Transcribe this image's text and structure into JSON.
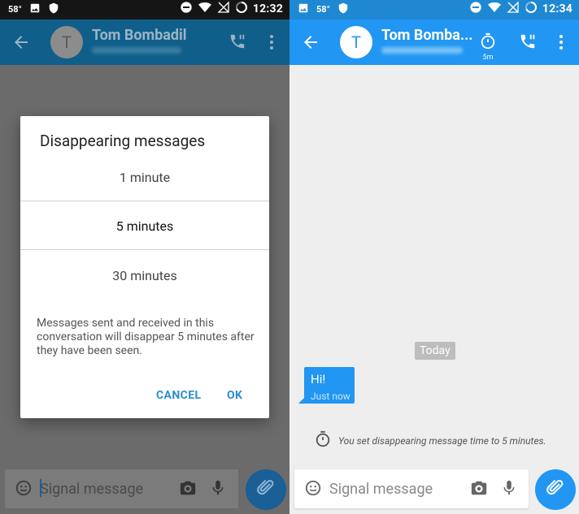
{
  "left": {
    "status": {
      "temp": "58°",
      "time": "12:32"
    },
    "appbar": {
      "avatar_letter": "T",
      "contact_name": "Tom Bombadil"
    },
    "dialog": {
      "title": "Disappearing messages",
      "options": [
        "1 minute",
        "5 minutes",
        "30 minutes"
      ],
      "selected": "5 minutes",
      "description": "Messages sent and received in this conversation will disappear 5 minutes after they have been seen.",
      "cancel_label": "CANCEL",
      "ok_label": "OK"
    },
    "compose": {
      "placeholder": "Signal message"
    }
  },
  "right": {
    "status": {
      "temp": "58°",
      "time": "12:34"
    },
    "appbar": {
      "avatar_letter": "T",
      "contact_name": "Tom Bomba...",
      "timer_label": "5m"
    },
    "conversation": {
      "date_divider": "Today",
      "messages": [
        {
          "text": "Hi!",
          "time": "Just now"
        }
      ],
      "system_message": "You set disappearing message time to 5 minutes."
    },
    "compose": {
      "placeholder": "Signal message"
    }
  },
  "colors": {
    "accent": "#2196f3",
    "appbar_dim": "#0f5f8a",
    "dim_background": "#6b6b6b",
    "dialog_button": "#2b8cd0"
  },
  "icons": [
    "image-icon",
    "shield-icon",
    "dnd-icon",
    "wifi-icon",
    "no-signal-icon",
    "battery-icon",
    "back-arrow-icon",
    "call-icon",
    "more-vert-icon",
    "timer-icon",
    "emoji-icon",
    "camera-icon",
    "mic-icon",
    "attach-icon"
  ]
}
